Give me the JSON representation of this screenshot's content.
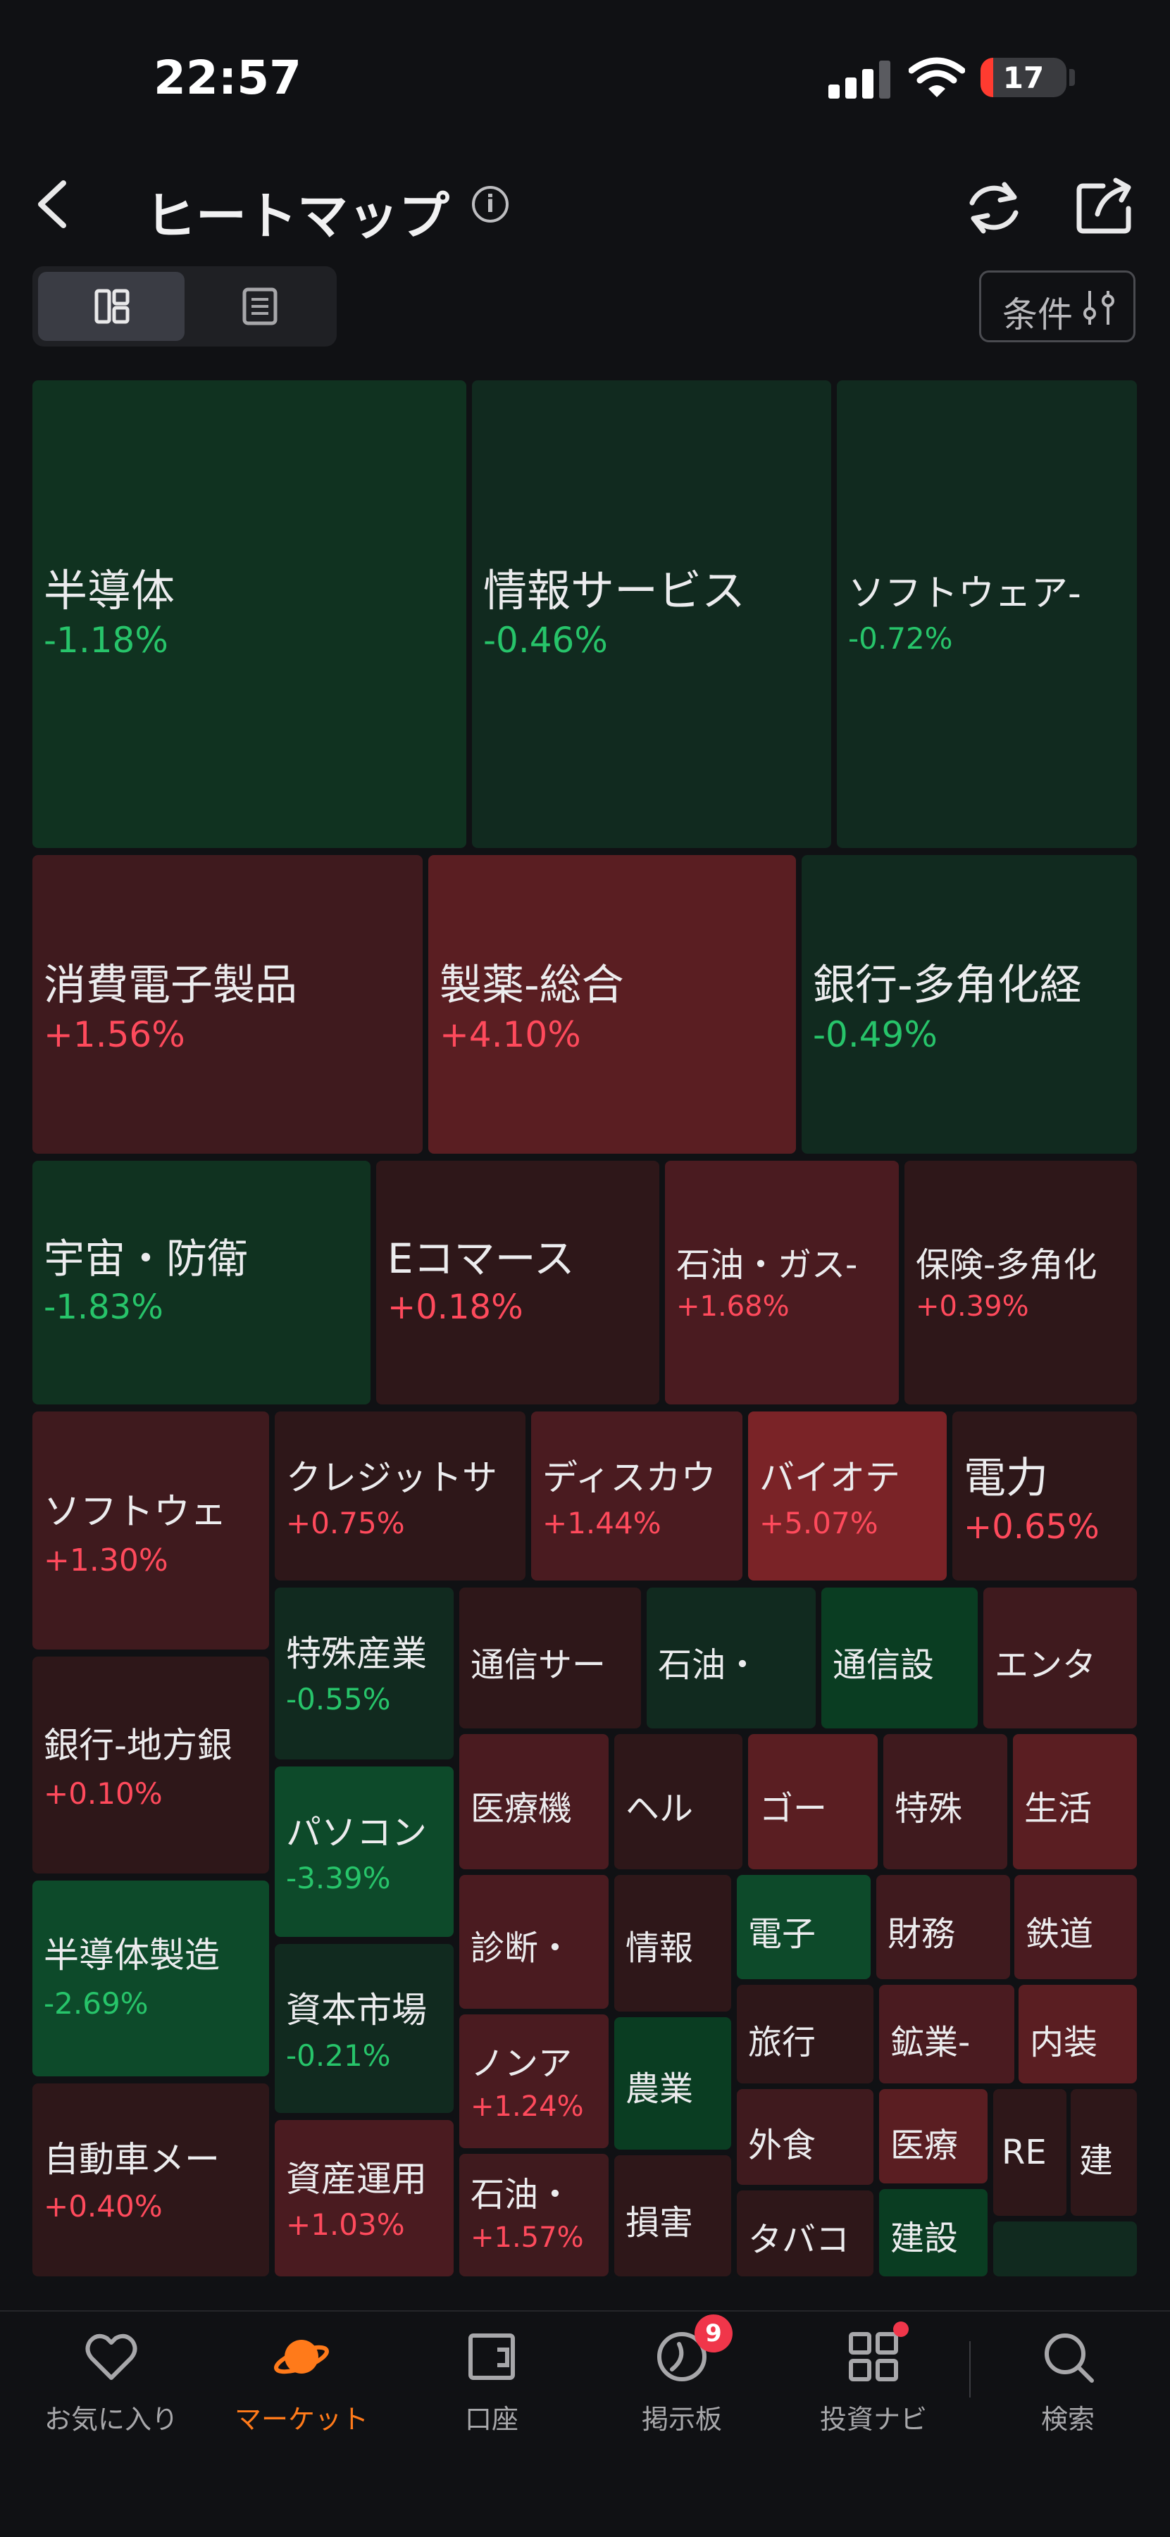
{
  "status": {
    "time": "22:57",
    "battery": "17"
  },
  "header": {
    "title": "ヒートマップ",
    "filter_label": "条件"
  },
  "heatmap": {
    "tiles": [
      {
        "name": "半導体",
        "change": "-1.18%"
      },
      {
        "name": "情報サービス",
        "change": "-0.46%"
      },
      {
        "name": "ソフトウェア-",
        "change": "-0.72%"
      },
      {
        "name": "消費電子製品",
        "change": "+1.56%"
      },
      {
        "name": "製薬-総合",
        "change": "+4.10%"
      },
      {
        "name": "銀行-多角化経",
        "change": "-0.49%"
      },
      {
        "name": "宇宙・防衛",
        "change": "-1.83%"
      },
      {
        "name": "Eコマース",
        "change": "+0.18%"
      },
      {
        "name": "石油・ガス-",
        "change": "+1.68%"
      },
      {
        "name": "保険-多角化",
        "change": "+0.39%"
      },
      {
        "name": "ソフトウェ",
        "change": "+1.30%"
      },
      {
        "name": "クレジットサ",
        "change": "+0.75%"
      },
      {
        "name": "ディスカウ",
        "change": "+1.44%"
      },
      {
        "name": "バイオテ",
        "change": "+5.07%"
      },
      {
        "name": "電力",
        "change": "+0.65%"
      },
      {
        "name": "銀行-地方銀",
        "change": "+0.10%"
      },
      {
        "name": "特殊産業",
        "change": "-0.55%"
      },
      {
        "name": "パソコン",
        "change": "-3.39%"
      },
      {
        "name": "半導体製造",
        "change": "-2.69%"
      },
      {
        "name": "資本市場",
        "change": "-0.21%"
      },
      {
        "name": "自動車メー",
        "change": "+0.40%"
      },
      {
        "name": "資産運用",
        "change": "+1.03%"
      },
      {
        "name": "ノンア",
        "change": "+1.24%"
      },
      {
        "name": "石油・",
        "change": "+1.57%"
      },
      {
        "name": "通信サー",
        "change": ""
      },
      {
        "name": "石油・",
        "change": ""
      },
      {
        "name": "通信設",
        "change": ""
      },
      {
        "name": "エンタ",
        "change": ""
      },
      {
        "name": "医療機",
        "change": ""
      },
      {
        "name": "ヘル",
        "change": ""
      },
      {
        "name": "ゴー",
        "change": ""
      },
      {
        "name": "特殊",
        "change": ""
      },
      {
        "name": "生活",
        "change": ""
      },
      {
        "name": "診断・",
        "change": ""
      },
      {
        "name": "情報",
        "change": ""
      },
      {
        "name": "電子",
        "change": ""
      },
      {
        "name": "財務",
        "change": ""
      },
      {
        "name": "鉄道",
        "change": ""
      },
      {
        "name": "農業",
        "change": ""
      },
      {
        "name": "旅行",
        "change": ""
      },
      {
        "name": "鉱業-",
        "change": ""
      },
      {
        "name": "内装",
        "change": ""
      },
      {
        "name": "損害",
        "change": ""
      },
      {
        "name": "外食",
        "change": ""
      },
      {
        "name": "医療",
        "change": ""
      },
      {
        "name": "RE",
        "change": ""
      },
      {
        "name": "建",
        "change": ""
      },
      {
        "name": "タバコ",
        "change": ""
      },
      {
        "name": "建設",
        "change": ""
      },
      {
        "name": "",
        "change": ""
      }
    ]
  },
  "nav": {
    "favorites": "お気に入り",
    "market": "マーケット",
    "account": "口座",
    "board": "掲示板",
    "board_badge": "9",
    "navi": "投資ナビ",
    "search": "検索"
  },
  "colors": {
    "accent": "#ff7a1a",
    "up": "#ff4a5c",
    "down": "#27c46a"
  }
}
